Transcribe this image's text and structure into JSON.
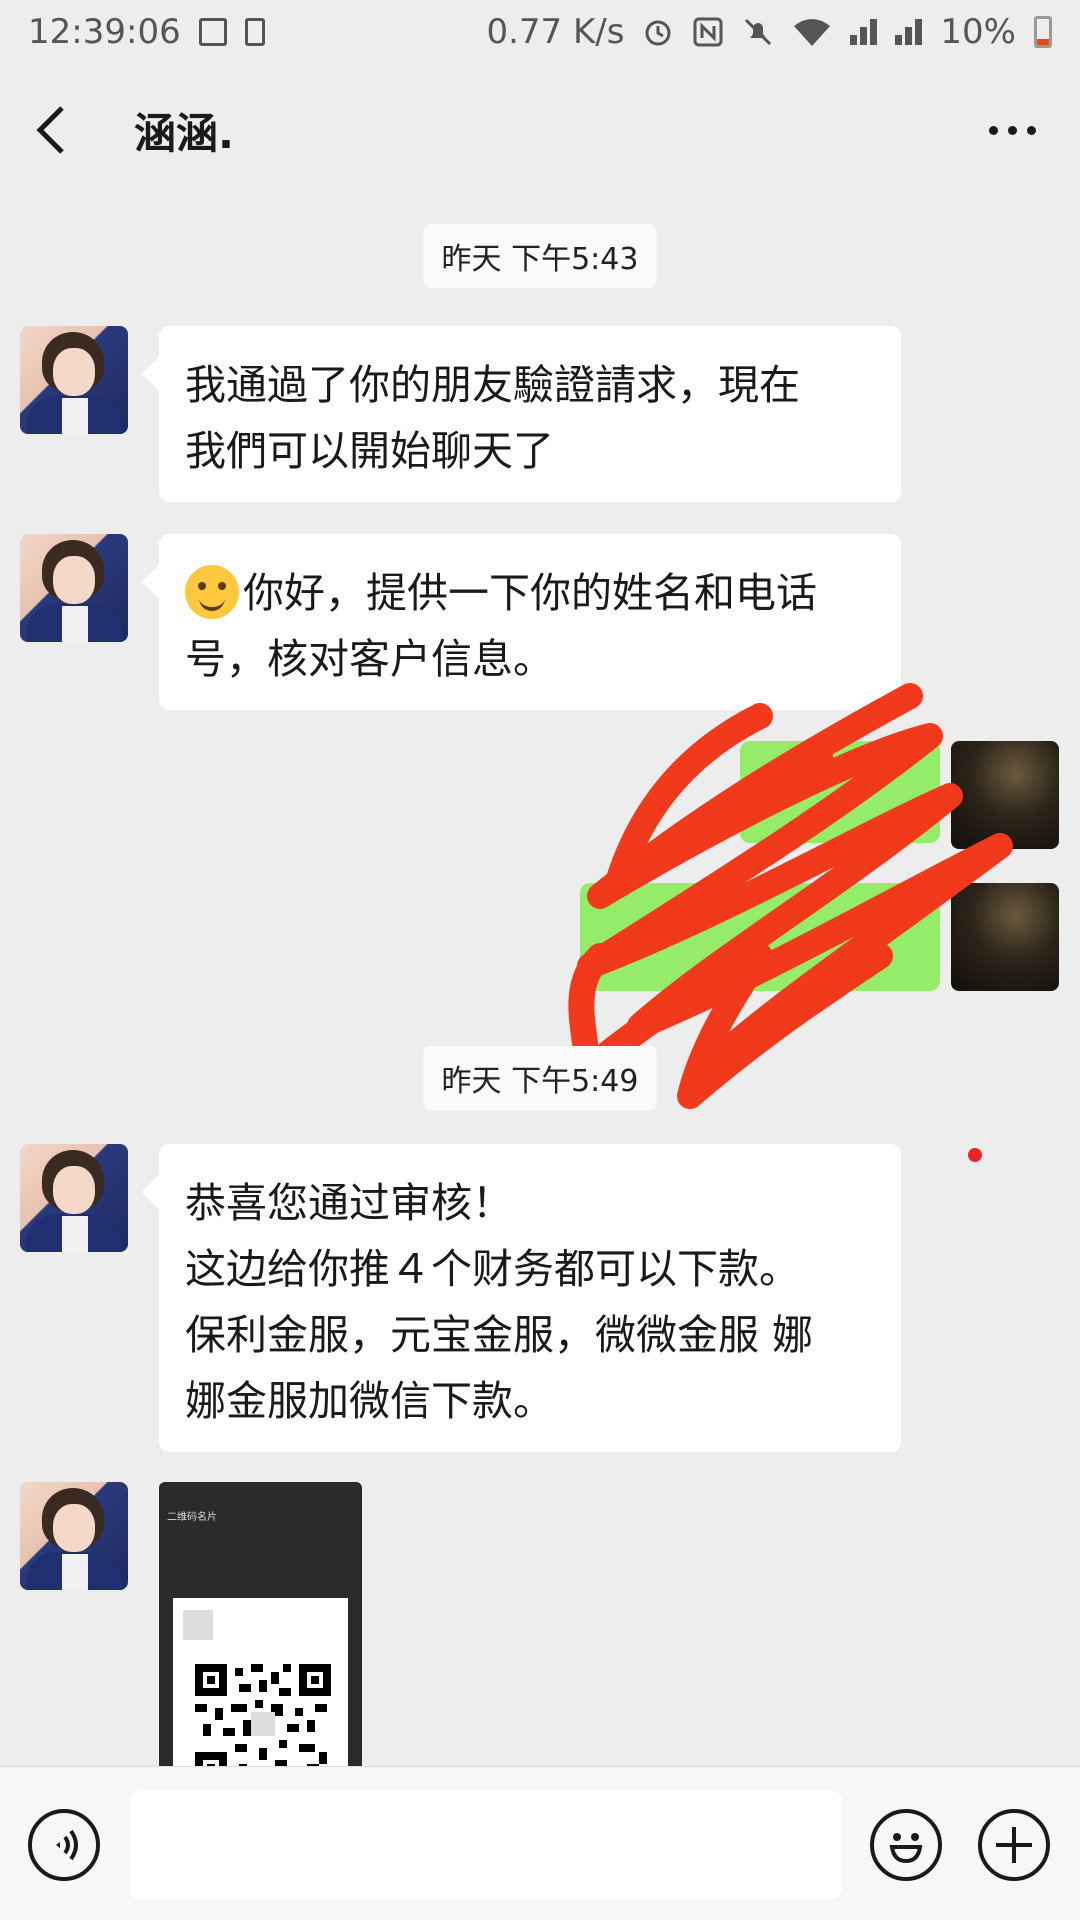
{
  "status_bar": {
    "time": "12:39:06",
    "network_speed": "0.77 K/s",
    "battery": "10%"
  },
  "header": {
    "title": "涵涵."
  },
  "messages": [
    {
      "type": "timestamp",
      "text": "昨天 下午5:43"
    },
    {
      "type": "received",
      "lines": [
        "我通過了你的朋友驗證請求，現在",
        "我們可以開始聊天了"
      ]
    },
    {
      "type": "received",
      "lines": [
        "你好，提供一下你的姓名和电话",
        "号，核对客户信息。"
      ]
    },
    {
      "type": "timestamp",
      "text": "昨天 下午5:49"
    },
    {
      "type": "received",
      "lines": [
        "恭喜您通过审核！",
        "这边给你推４个财务都可以下款。",
        "保利金服，元宝金服，微微金服 娜",
        "娜金服加微信下款。"
      ]
    },
    {
      "type": "received-image",
      "caption": "二维码名片"
    }
  ],
  "colors": {
    "background": "#ededed",
    "sent_bubble": "#95ec69",
    "received_bubble": "#ffffff",
    "redaction": "#f13a1c",
    "unread_dot": "#e8242a"
  },
  "icons": [
    "back-icon",
    "more-icon",
    "voice-icon",
    "emoji-icon",
    "add-icon",
    "smile-emoji"
  ]
}
